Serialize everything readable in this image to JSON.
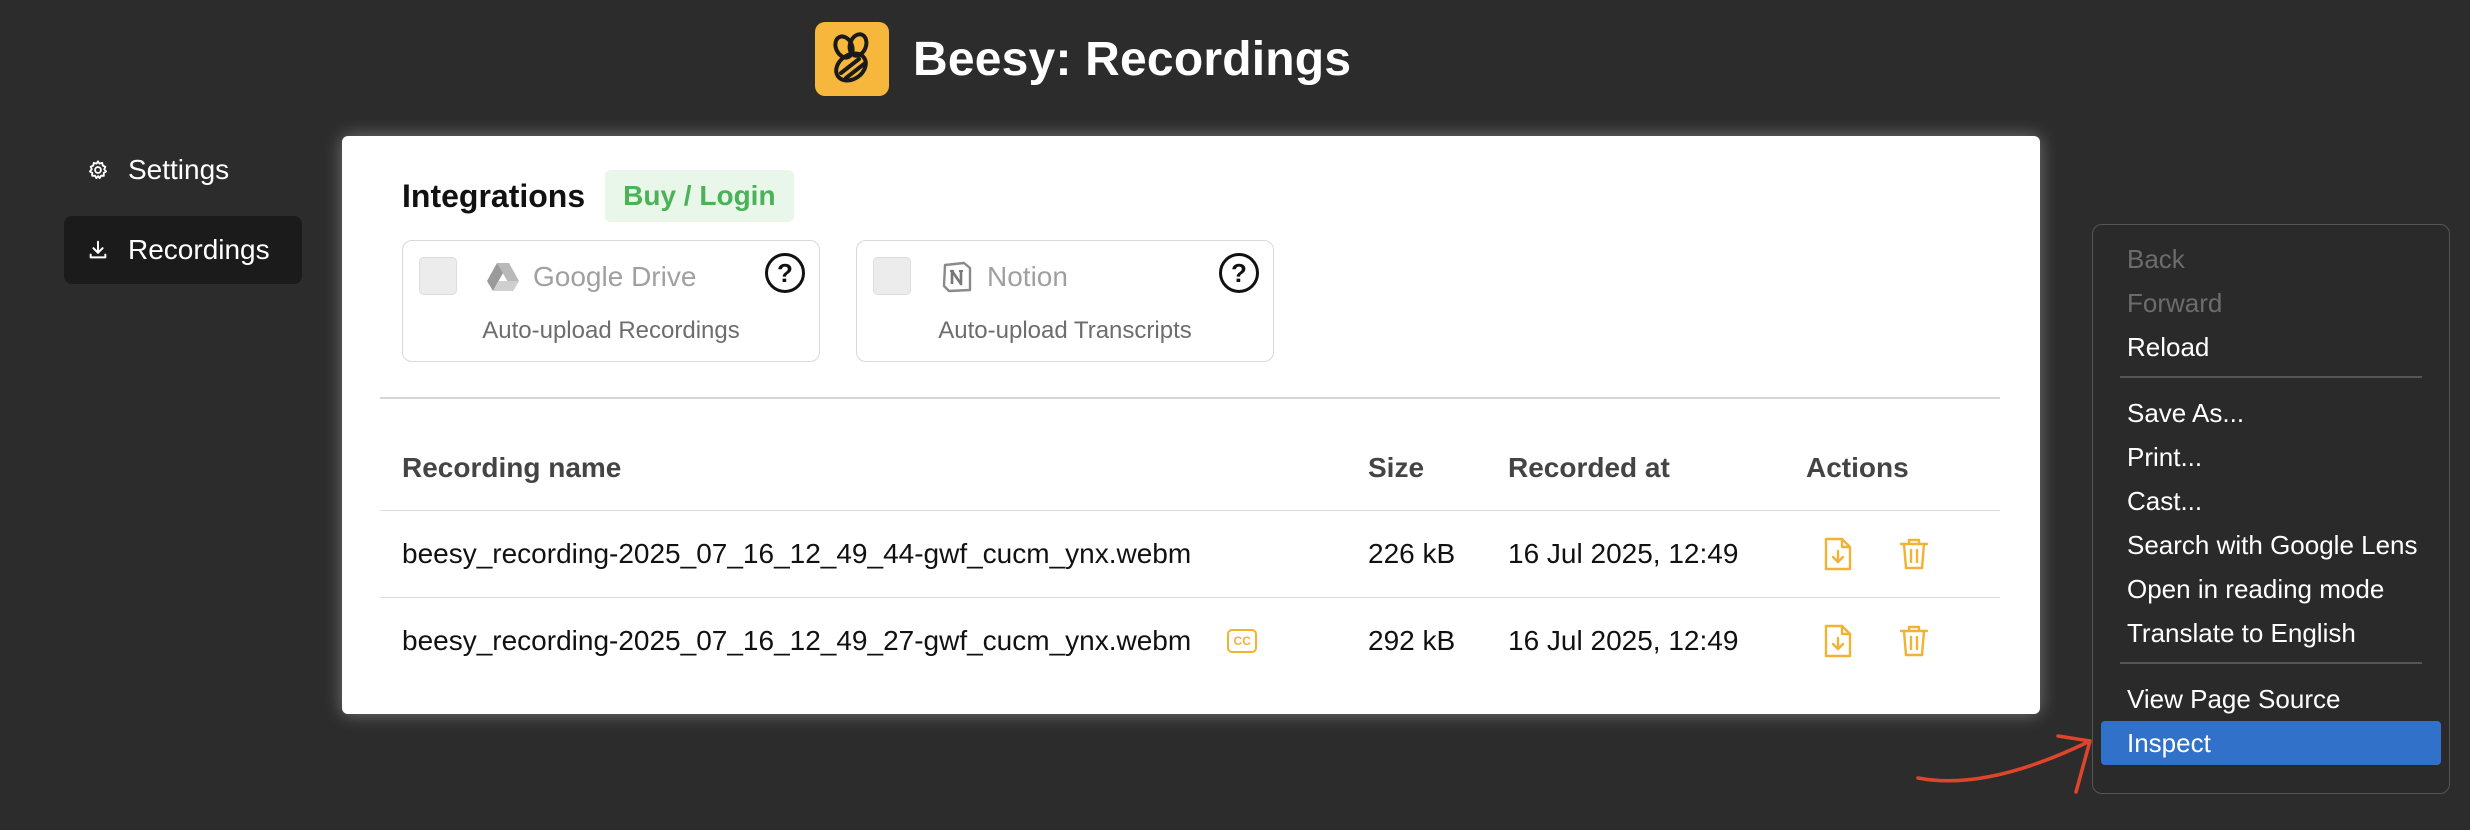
{
  "header": {
    "title": "Beesy: Recordings"
  },
  "sidebar": {
    "items": [
      {
        "label": "Settings",
        "icon": "gear-icon"
      },
      {
        "label": "Recordings",
        "icon": "download-icon"
      }
    ]
  },
  "integrations": {
    "title": "Integrations",
    "buy_label": "Buy / Login",
    "services": [
      {
        "name": "Google Drive",
        "subtitle": "Auto-upload Recordings",
        "icon": "google-drive-icon"
      },
      {
        "name": "Notion",
        "subtitle": "Auto-upload Transcripts",
        "icon": "notion-icon"
      }
    ]
  },
  "table": {
    "headers": {
      "name": "Recording name",
      "size": "Size",
      "recorded": "Recorded at",
      "actions": "Actions"
    },
    "rows": [
      {
        "name": "beesy_recording-2025_07_16_12_49_44-gwf_cucm_ynx.webm",
        "size": "226 kB",
        "recorded": "16 Jul 2025, 12:49",
        "has_cc": false
      },
      {
        "name": "beesy_recording-2025_07_16_12_49_27-gwf_cucm_ynx.webm",
        "size": "292 kB",
        "recorded": "16 Jul 2025, 12:49",
        "has_cc": true
      }
    ]
  },
  "context_menu": {
    "items": [
      {
        "label": "Back",
        "disabled": true
      },
      {
        "label": "Forward",
        "disabled": true
      },
      {
        "label": "Reload"
      },
      {
        "label": "Save As..."
      },
      {
        "label": "Print..."
      },
      {
        "label": "Cast..."
      },
      {
        "label": "Search with Google Lens"
      },
      {
        "label": "Open in reading mode"
      },
      {
        "label": "Translate to English"
      },
      {
        "label": "View Page Source"
      },
      {
        "label": "Inspect",
        "highlighted": true
      }
    ]
  },
  "colors": {
    "background": "#2c2c2c",
    "accent": "#f2b233",
    "buy_bg": "#e8f7e9",
    "buy_text": "#4cb257",
    "menu_highlight": "#3271c9",
    "annotation_arrow": "#e0452b"
  }
}
